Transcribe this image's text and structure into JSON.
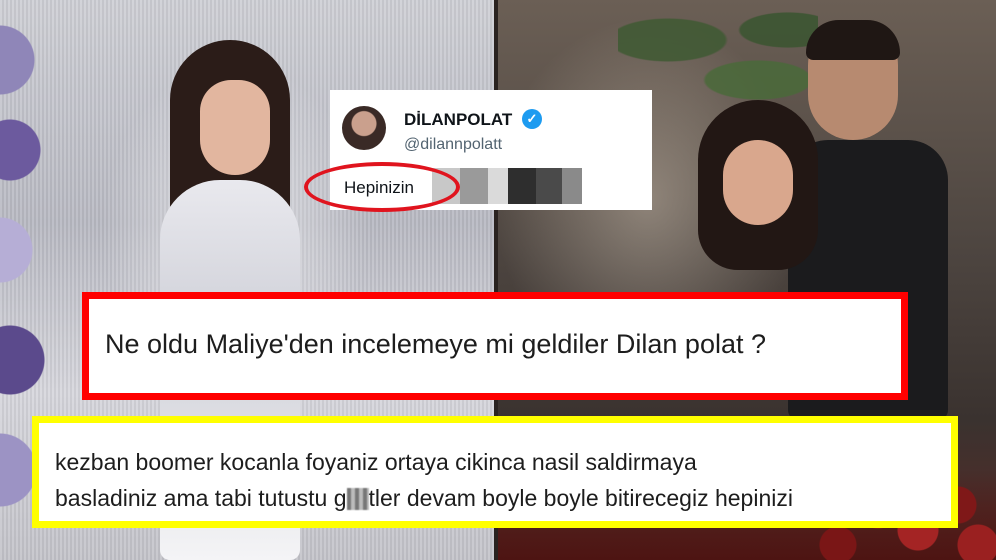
{
  "tweet": {
    "name": "DİLANPOLAT",
    "handle": "@dilannpolatt",
    "text": "Hepinizin"
  },
  "comment_red": {
    "text": "Ne oldu Maliye'den incelemeye mi geldiler Dilan polat ?",
    "border_color": "#ff0000"
  },
  "comment_yellow": {
    "line1": "kezban boomer kocanla foyaniz ortaya cikinca nasil saldirmaya",
    "line2_before": "basladiniz ama tabi tutustu g",
    "line2_after": "tler devam boyle boyle bitirecegiz hepinizi",
    "border_color": "#ffff00"
  },
  "icons": [
    "verified-icon",
    "avatar"
  ]
}
